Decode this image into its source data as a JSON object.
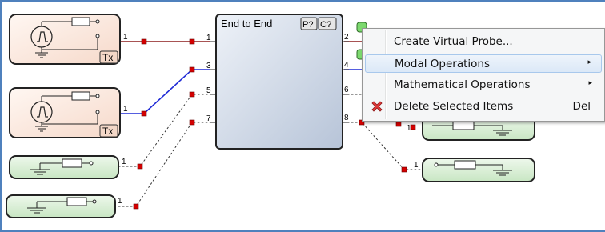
{
  "block": {
    "title": "End to End",
    "badges": [
      "P?",
      "C?"
    ],
    "ports": [
      "1",
      "2",
      "3",
      "4",
      "5",
      "6",
      "7",
      "8"
    ]
  },
  "sources": [
    {
      "tag": "Tx",
      "port": "1"
    },
    {
      "tag": "Tx",
      "port": "1"
    }
  ],
  "loads": [
    {
      "port": "1"
    },
    {
      "port": "1"
    },
    {
      "port": "1"
    },
    {
      "port": "1"
    }
  ],
  "context_menu": {
    "items": [
      {
        "label": "Create Virtual Probe...",
        "shortcut": "",
        "submenu": false,
        "icon": ""
      },
      {
        "label": "Modal Operations",
        "shortcut": "",
        "submenu": true,
        "icon": "",
        "highlighted": true
      },
      {
        "label": "Mathematical Operations",
        "shortcut": "",
        "submenu": true,
        "icon": ""
      },
      {
        "label": "Delete Selected Items",
        "shortcut": "Del",
        "submenu": false,
        "icon": "red-x-delete-icon"
      }
    ],
    "submenu_glyph": "▸"
  },
  "colors": {
    "source_fill": "#fbe6dc",
    "load_fill": "#d8efd5",
    "block_fill": "#c9d4e3",
    "wire_red": "#8b1a1a",
    "wire_blue": "#1f2ad6",
    "pin_red": "#d40000",
    "probe_green": "#7dd96f",
    "menu_highlight": "#dbe8f7",
    "frame_blue": "#4f81bd"
  }
}
